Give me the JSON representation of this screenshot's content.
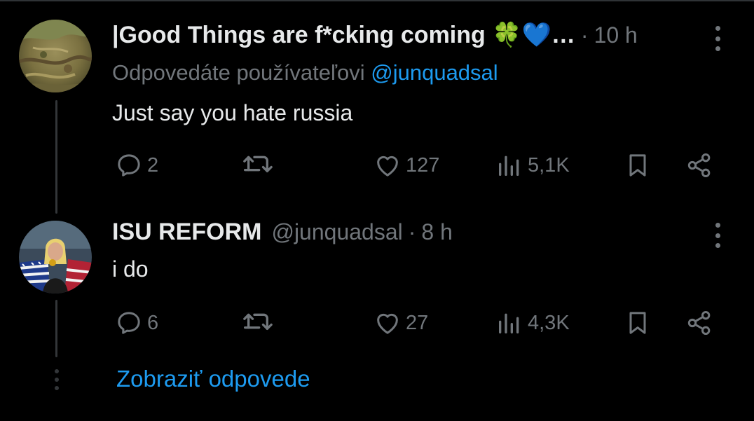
{
  "tweets": [
    {
      "author_name": "|Good Things are f*cking coming 🍀💙…",
      "handle": "",
      "time": "10 h",
      "reply_to_prefix": "Odpovedáte používateľovi",
      "reply_to_handle": "@junquadsal",
      "text": "Just say you hate russia",
      "replies": "2",
      "retweets": "",
      "likes": "127",
      "views": "5,1K",
      "avatar_icon": "painting-avatar"
    },
    {
      "author_name": "ISU REFORM",
      "handle": "@junquadsal",
      "time": "8 h",
      "text": "i do",
      "replies": "6",
      "retweets": "",
      "likes": "27",
      "views": "4,3K",
      "avatar_icon": "athlete-avatar"
    }
  ],
  "separator": "·",
  "show_replies_label": "Zobraziť odpovede",
  "colors": {
    "background": "#000000",
    "text": "#e7e9ea",
    "muted": "#71767b",
    "accent": "#1d9bf0",
    "line": "#333639"
  }
}
